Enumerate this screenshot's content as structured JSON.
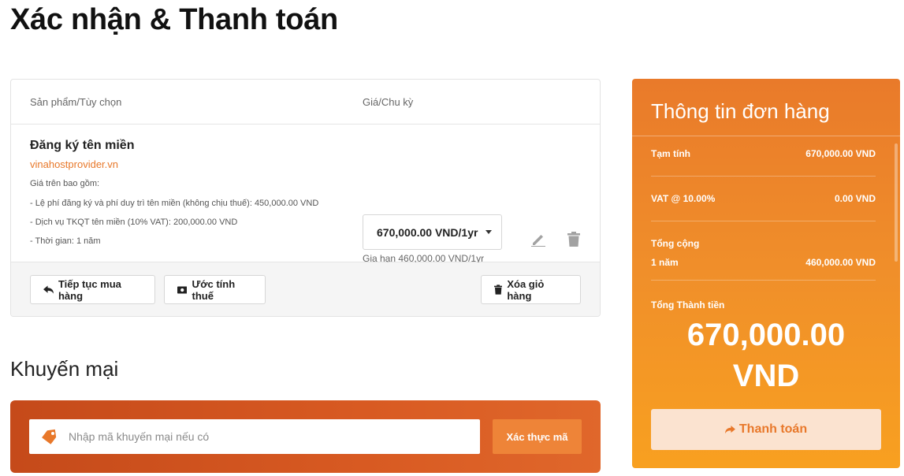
{
  "page": {
    "title": "Xác nhận & Thanh toán"
  },
  "cart": {
    "header": {
      "product": "Sản phẩm/Tùy chọn",
      "price": "Giá/Chu kỳ"
    },
    "item": {
      "title": "Đăng ký tên miền",
      "domain": "vinahostprovider.vn",
      "details": [
        "Giá trên bao gồm:",
        "- Lệ phí đăng ký và phí duy trì tên miền (không chịu thuế): 450,000.00 VND",
        "- Dịch vụ TKQT tên miền (10% VAT): 200,000.00 VND",
        "- Thời gian: 1 năm"
      ],
      "billing_cycle": "670,000.00 VND/1yr",
      "renewal_note": "Gia hạn 460,000.00 VND/1yr"
    },
    "actions": {
      "continue": "Tiếp tục mua hàng",
      "estimate_tax": "Ước tính thuế",
      "empty_cart": "Xóa giỏ hàng"
    }
  },
  "promo": {
    "heading": "Khuyến mại",
    "placeholder": "Nhập mã khuyến mại nếu có",
    "value": "",
    "validate_button": "Xác thực mã"
  },
  "summary": {
    "title": "Thông tin đơn hàng",
    "rows": [
      {
        "label": "Tạm tính",
        "value": "670,000.00 VND"
      },
      {
        "label": "VAT @ 10.00%",
        "value": "0.00 VND"
      }
    ],
    "recurring": {
      "label": "Tổng cộng",
      "period": "1 năm",
      "value": "460,000.00 VND"
    },
    "total_label": "Tổng Thành tiền",
    "total_amount": "670,000.00",
    "total_currency": "VND",
    "checkout_button": "Thanh toán"
  },
  "colors": {
    "accent": "#e8782a",
    "summary_top": "#e97a2a",
    "summary_bottom": "#f8a020",
    "promo_bar": "#d85a22",
    "checkout_bg": "#fbe3d0"
  },
  "icons": {
    "continue": "reply-arrow-icon",
    "estimate_tax": "money-bill-icon",
    "empty_cart": "trash-icon",
    "edit": "pencil-icon",
    "delete": "trash-icon",
    "promo": "tag-icon",
    "checkout": "share-arrow-icon"
  }
}
